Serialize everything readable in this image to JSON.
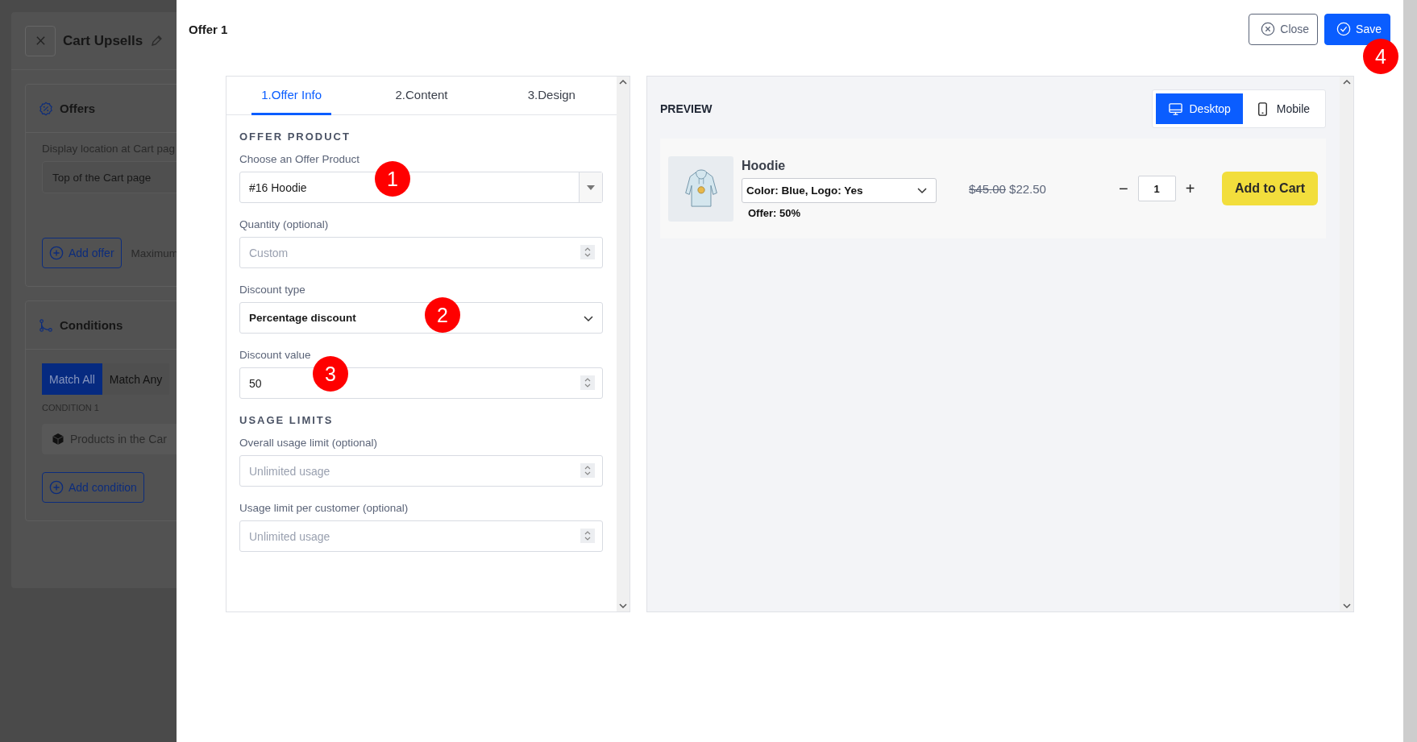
{
  "background_page": {
    "title": "Cart Upsells",
    "offers": {
      "title": "Offers",
      "location_label": "Display location at Cart pag",
      "location_value": "Top of the Cart page",
      "add_button": "Add offer",
      "note": "Maximum"
    },
    "conditions": {
      "title": "Conditions",
      "match_tabs": [
        {
          "label": "Match All",
          "selected": true
        },
        {
          "label": "Match Any",
          "selected": false
        }
      ],
      "condition_label": "CONDITION 1",
      "condition_value": "Products in the Car",
      "add_button": "Add condition"
    }
  },
  "modal": {
    "title": "Offer 1",
    "close_button": "Close",
    "save_button": "Save",
    "tabs": [
      {
        "label": "1.Offer Info",
        "selected": true
      },
      {
        "label": "2.Content",
        "selected": false
      },
      {
        "label": "3.Design",
        "selected": false
      }
    ],
    "sections": [
      {
        "heading": "OFFER PRODUCT",
        "fields": [
          {
            "kind": "combobox",
            "label": "Choose an Offer Product",
            "value": "#16 Hoodie"
          },
          {
            "kind": "number",
            "label": "Quantity (optional)",
            "placeholder": "Custom"
          },
          {
            "kind": "select",
            "label": "Discount type",
            "value": "Percentage discount"
          },
          {
            "kind": "number",
            "label": "Discount value",
            "value": "50"
          }
        ]
      },
      {
        "heading": "USAGE LIMITS",
        "fields": [
          {
            "kind": "number",
            "label": "Overall usage limit (optional)",
            "placeholder": "Unlimited usage"
          },
          {
            "kind": "number",
            "label": "Usage limit per customer (optional)",
            "placeholder": "Unlimited usage"
          }
        ]
      }
    ],
    "preview": {
      "title": "PREVIEW",
      "devices": [
        {
          "kind": "desktop",
          "label": "Desktop",
          "selected": true
        },
        {
          "kind": "mobile",
          "label": "Mobile",
          "selected": false
        }
      ],
      "product": {
        "name": "Hoodie",
        "variant": "Color: Blue, Logo: Yes",
        "offer": "Offer: 50%",
        "old_price": "$45.00",
        "new_price": "$22.50",
        "quantity": "1",
        "minus": "−",
        "plus": "+",
        "button": "Add to Cart"
      }
    }
  },
  "annotations": [
    "1",
    "2",
    "3",
    "4"
  ]
}
